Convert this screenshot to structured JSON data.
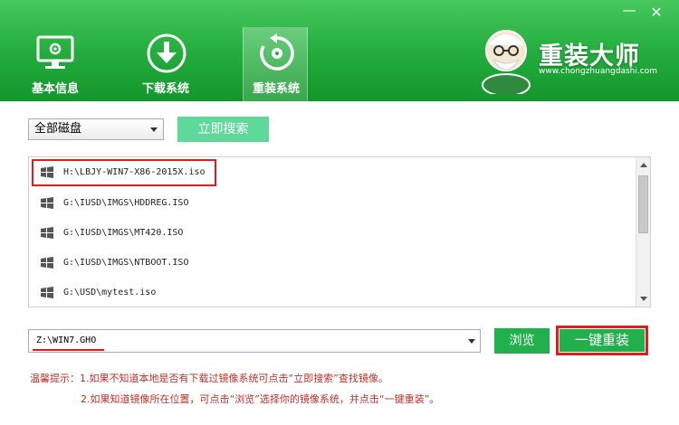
{
  "window": {
    "minimize_glyph": "—",
    "close_glyph": "✕"
  },
  "nav": {
    "tabs": [
      {
        "label": "基本信息",
        "icon": "monitor-gear-icon",
        "active": false
      },
      {
        "label": "下载系统",
        "icon": "download-arrow-icon",
        "active": false
      },
      {
        "label": "重装系统",
        "icon": "refresh-disc-icon",
        "active": true
      }
    ]
  },
  "brand": {
    "name": "重装大师",
    "url": "www.chongzhuangdashi.com",
    "mascot_icon": "mascot-old-man-icon"
  },
  "search": {
    "disk_select_value": "全部磁盘",
    "search_button": "立即搜索"
  },
  "image_list": {
    "items": [
      {
        "path": "H:\\LBJY-WIN7-X86-2015X.iso",
        "icon": "windows-logo-icon",
        "highlighted": true
      },
      {
        "path": "G:\\IUSD\\IMGS\\HDDREG.ISO",
        "icon": "windows-logo-icon",
        "highlighted": false
      },
      {
        "path": "G:\\IUSD\\IMGS\\MT420.ISO",
        "icon": "windows-logo-icon",
        "highlighted": false
      },
      {
        "path": "G:\\IUSD\\IMGS\\NTBOOT.ISO",
        "icon": "windows-logo-icon",
        "highlighted": false
      },
      {
        "path": "G:\\USD\\mytest.iso",
        "icon": "windows-logo-icon",
        "highlighted": false
      }
    ]
  },
  "target": {
    "path_value": "Z:\\WIN7.GHO",
    "browse_button": "浏览",
    "reinstall_button": "一键重装"
  },
  "tips": {
    "line1": "温馨提示：1.如果不知道本地是否有下载过镜像系统可点击“立即搜索”查找镜像。",
    "line2": "2.如果知道镜像所在位置，可点击“浏览”选择你的镜像系统，并点击“一键重装”。"
  },
  "colors": {
    "header_green": "#22ab3c",
    "button_green": "#21b04b",
    "search_button": "#5fd99a",
    "highlight_red": "#e51b1b",
    "tip_text": "#c0302a"
  }
}
